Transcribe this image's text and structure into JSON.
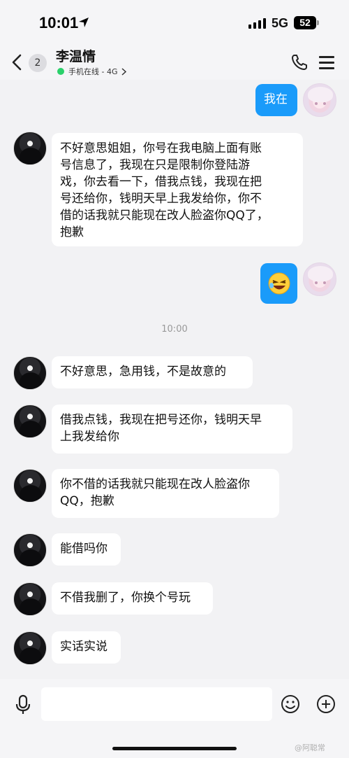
{
  "status_bar": {
    "time": "10:01",
    "network": "5G",
    "battery": "52"
  },
  "header": {
    "unread_count": "2",
    "contact_name": "李温情",
    "online_status": "手机在线 - 4G"
  },
  "messages": [
    {
      "side": "right",
      "type": "text",
      "text": "我在"
    },
    {
      "side": "left",
      "type": "text",
      "lines": [
        "不好意思姐姐，你号在我电脑上面有账",
        "号信息了，我现在只是限制你登陆游",
        "戏，你去看一下，借我点钱，我现在把",
        "号还给你，钱明天早上我发给你，你不",
        "借的话我就只能现在改人脸盗你QQ了，",
        "抱歉"
      ]
    },
    {
      "side": "right",
      "type": "sticker",
      "icon": "laughing-emoji"
    },
    {
      "type": "timestamp",
      "text": "10:00"
    },
    {
      "side": "left",
      "type": "text",
      "lines": [
        "不好意思，急用钱，不是故意的"
      ]
    },
    {
      "side": "left",
      "type": "text",
      "lines": [
        "借我点钱，我现在把号还你，钱明天早",
        "上我发给你"
      ]
    },
    {
      "side": "left",
      "type": "text",
      "lines": [
        "你不借的话我就只能现在改人脸盗你",
        "QQ，抱歉"
      ]
    },
    {
      "side": "left",
      "type": "text",
      "lines": [
        "能借吗你"
      ]
    },
    {
      "side": "left",
      "type": "text",
      "lines": [
        "不借我删了，你换个号玩"
      ]
    },
    {
      "side": "left",
      "type": "text",
      "lines": [
        "实话实说"
      ]
    }
  ],
  "input_bar": {
    "value": "",
    "placeholder": ""
  },
  "watermark": "@阿聪常",
  "colors": {
    "sent_bubble": "#1a9bfa",
    "received_bubble": "#ffffff",
    "background": "#f2f2f4",
    "online_dot": "#2bd16b"
  }
}
